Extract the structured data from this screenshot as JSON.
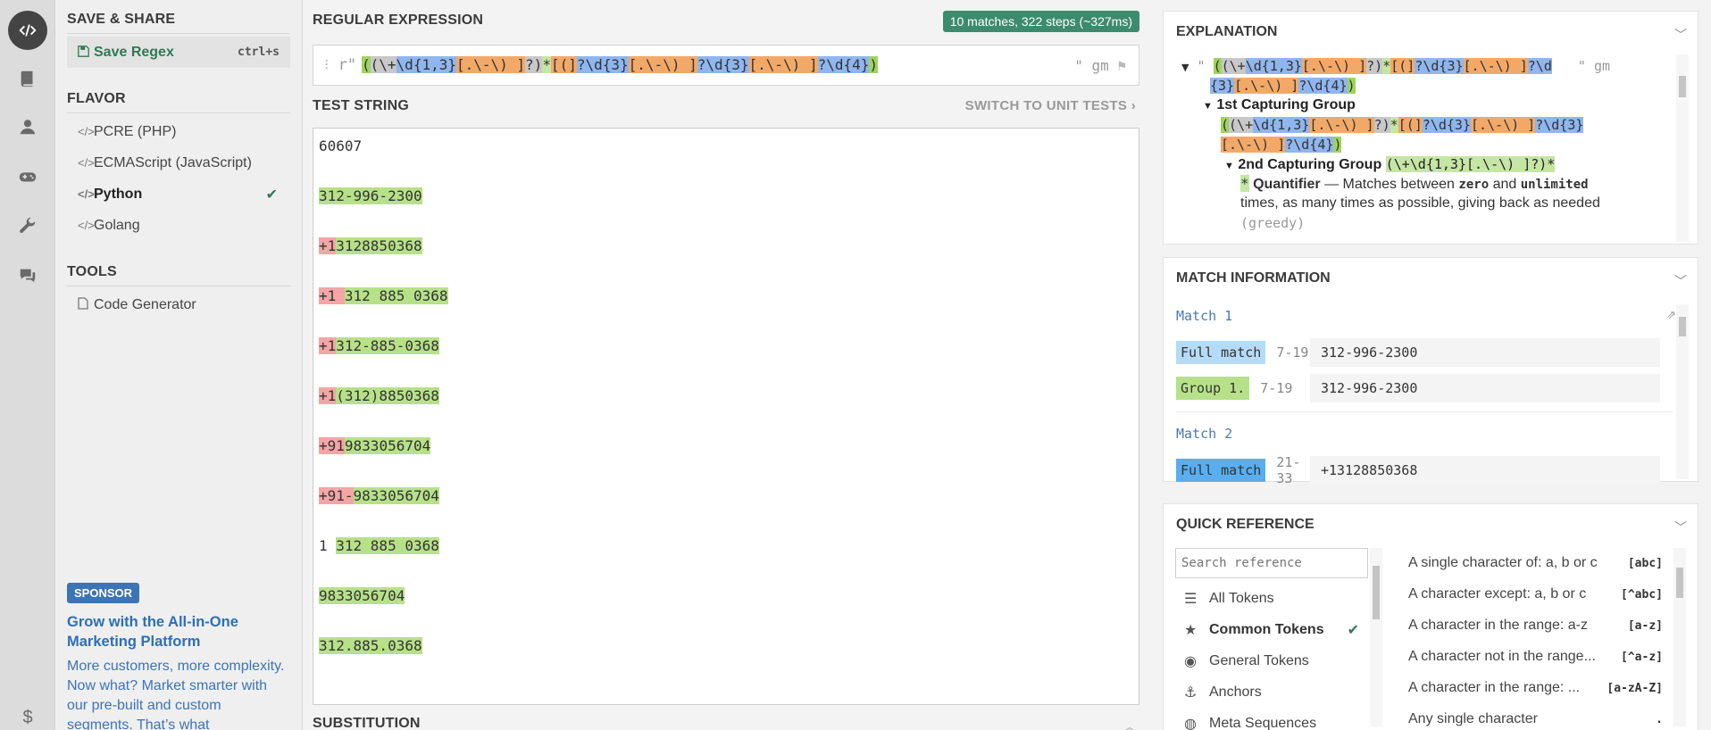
{
  "rail": {
    "items": [
      "code-icon",
      "book-icon",
      "user-icon",
      "gamepad-icon",
      "wrench-icon",
      "chat-icon",
      "dollar-icon"
    ]
  },
  "sidebar": {
    "save_share_title": "SAVE & SHARE",
    "save_label": "Save Regex",
    "save_shortcut": "ctrl+s",
    "flavor_title": "FLAVOR",
    "flavors": [
      "PCRE (PHP)",
      "ECMAScript (JavaScript)",
      "Python",
      "Golang"
    ],
    "selected_flavor": "Python",
    "tools_title": "TOOLS",
    "tools": [
      "Code Generator"
    ],
    "sponsor_badge": "SPONSOR",
    "sponsor_heading": "Grow with the All-in-One Marketing Platform",
    "sponsor_body": "More customers, more complexity. Now what? Market smarter with our pre-built and custom segments. That’s what"
  },
  "regex": {
    "title": "REGULAR EXPRESSION",
    "matches_badge": "10 matches, 322 steps (~327ms)",
    "prefix": "r\"",
    "pattern": "((\\+\\d{1,3}[.\\-\\) ]?)*[(]?\\d{3}[.\\-\\) ]?\\d{3}[.\\-\\) ]?\\d{4})",
    "suffix": "\" gm"
  },
  "test": {
    "title": "TEST STRING",
    "switch_label": "SWITCH TO UNIT TESTS",
    "lines": [
      {
        "plain": "60607",
        "red": "",
        "green": ""
      },
      {
        "plain": "",
        "red": "",
        "green": "312-996-2300"
      },
      {
        "plain": "",
        "red": "+1",
        "green": "3128850368"
      },
      {
        "plain": "",
        "red": "+1 ",
        "green": "312 885 0368"
      },
      {
        "plain": "",
        "red": "+1",
        "green": "312-885-0368"
      },
      {
        "plain": "",
        "red": "+1",
        "green": "(312)8850368"
      },
      {
        "plain": "",
        "red": "+91",
        "green": "9833056704"
      },
      {
        "plain": "",
        "red": "+91-",
        "green": "9833056704"
      },
      {
        "plain": "1 ",
        "red": "",
        "green": "312 885 0368"
      },
      {
        "plain": "",
        "red": "",
        "green": "9833056704"
      },
      {
        "plain": "",
        "red": "",
        "green": "312.885.0368"
      }
    ],
    "substitution_title": "SUBSTITUTION"
  },
  "explanation": {
    "title": "EXPLANATION",
    "line1_prefix": "\"",
    "line1_suffix": "\" gm",
    "group1_label": "1st Capturing Group",
    "group2_label": "2nd Capturing Group",
    "group2_pattern": "(\\+\\d{1,3}[.\\-\\) ]?)*",
    "quantifier_label": "Quantifier",
    "quantifier_text_a": " — Matches between ",
    "quantifier_zero": "zero",
    "quantifier_and": " and ",
    "quantifier_unlimited": "unlimited",
    "quantifier_text_b": "times, as many times as possible, giving back as needed",
    "quantifier_greedy": "(greedy)"
  },
  "match_info": {
    "title": "MATCH INFORMATION",
    "matches": [
      {
        "label": "Match 1",
        "rows": [
          {
            "tag": "Full match",
            "range": "7-19",
            "value": "312-996-2300"
          },
          {
            "tag": "Group 1.",
            "range": "7-19",
            "value": "312-996-2300"
          }
        ]
      },
      {
        "label": "Match 2",
        "rows": [
          {
            "tag": "Full match",
            "range": "21-33",
            "value": "+13128850368"
          }
        ]
      }
    ]
  },
  "quick_ref": {
    "title": "QUICK REFERENCE",
    "search_placeholder": "Search reference",
    "categories": [
      "All Tokens",
      "Common Tokens",
      "General Tokens",
      "Anchors",
      "Meta Sequences"
    ],
    "selected_category": "Common Tokens",
    "refs": [
      {
        "text": "A single character of: a, b or c",
        "code": "[abc]"
      },
      {
        "text": "A character except: a, b or c",
        "code": "[^abc]"
      },
      {
        "text": "A character in the range: a-z",
        "code": "[a-z]"
      },
      {
        "text": "A character not in the range...",
        "code": "[^a-z]"
      },
      {
        "text": "A character in the range: ...",
        "code": "[a-zA-Z]"
      },
      {
        "text": "Any single character",
        "code": "."
      }
    ]
  },
  "colors": {
    "accent_green": "#2e7a55",
    "badge_green": "#3d8b6e",
    "match_green": "#b7e189",
    "unmatched_red": "#f4a5a5",
    "link_blue": "#3c74b6"
  }
}
